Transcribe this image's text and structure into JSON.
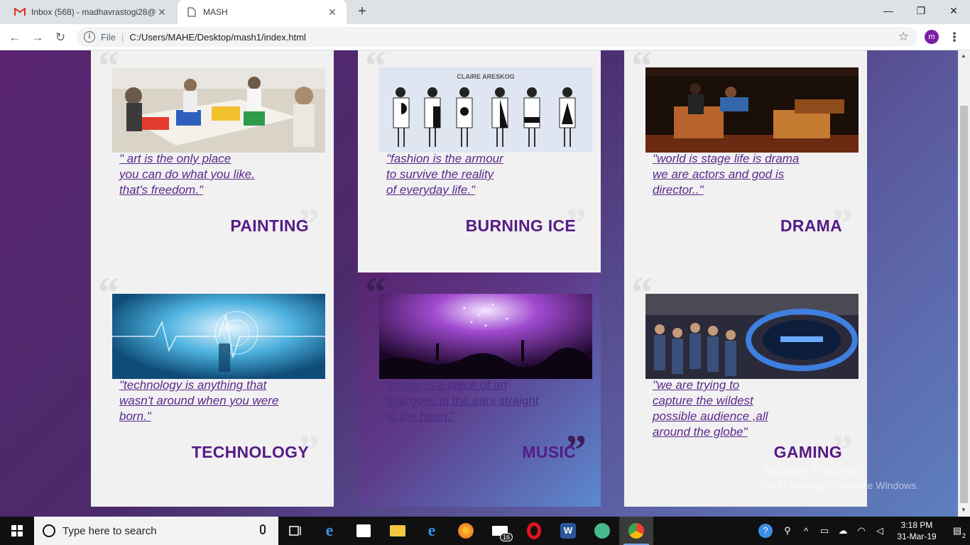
{
  "browser": {
    "tabs": [
      {
        "title": "Inbox (568) - madhavrastogi28@",
        "icon": "gmail-icon",
        "active": false
      },
      {
        "title": "MASH",
        "icon": "page-icon",
        "active": true
      }
    ],
    "address": {
      "scheme_label": "File",
      "url": "C:/Users/MAHE/Desktop/mash1/index.html"
    },
    "profile_initial": "m"
  },
  "cards": [
    {
      "quote": "\" art is the only place\nyou can do what you like.\nthat's freedom.\"",
      "label": "PAINTING",
      "image": "painting-class-photo"
    },
    {
      "quote": "\"fashion is the armour\nto survive the reality\nof everyday life.\"",
      "label": "BURNING ICE",
      "image": "fashion-show-photo",
      "image_caption": "CLAIRE ARESKOG"
    },
    {
      "quote": "\"world is stage life is drama\nwe are actors and god is\ndirector..\"",
      "label": "DRAMA",
      "image": "stage-play-photo"
    },
    {
      "quote": "\"technology is anything that\nwasn't around when you were\nborn.\"",
      "label": "TECHNOLOGY",
      "image": "tech-hologram-photo"
    },
    {
      "quote": "\"music is a piece of art\nthat goes in the ears straight\nto the heart.\"",
      "label": "MUSIC",
      "image": "concert-crowd-photo",
      "hovered": true
    },
    {
      "quote": "\"we are trying to \ncapture the wildest\npossible audience ,all\naround the globe\"",
      "label": "GAMING",
      "image": "gaming-arena-photo"
    }
  ],
  "watermark": {
    "title": "Activate Windows",
    "subtitle": "Go to Settings to activate Windows."
  },
  "taskbar": {
    "search_placeholder": "Type here to search",
    "mail_badge": "16",
    "time": "3:18 PM",
    "date": "31-Mar-19",
    "notification_count": "2"
  },
  "colors": {
    "accent_purple": "#561c86",
    "page_gradient_start": "#5a2470",
    "page_gradient_end": "#5d7fc0"
  }
}
